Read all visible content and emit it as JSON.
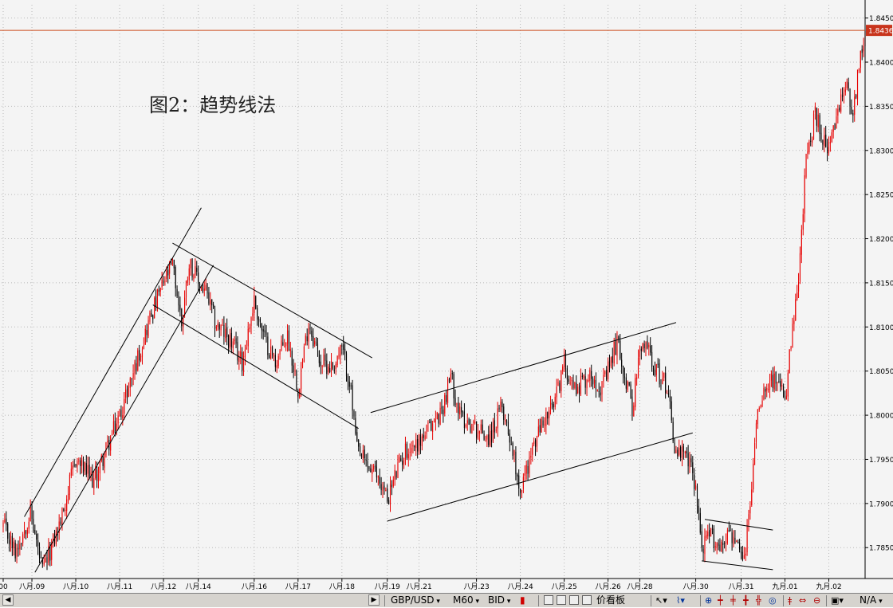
{
  "annotation": "图2：趋势线法",
  "colors": {
    "background": "#f4f4f4",
    "grid": "#b8b8b8",
    "bull": "#e60000",
    "bear": "#000000",
    "trendline": "#000000",
    "price_line": "#cc4b1a",
    "price_box_bg": "#c8341c"
  },
  "bottom_bar": {
    "symbol": "GBP/USD",
    "timeframe": "M60",
    "price_type": "BID",
    "panel": "价看板",
    "status": "N/A"
  },
  "chart_data": {
    "type": "candlestick",
    "title": "",
    "timeframe": "H1",
    "ylim": [
      1.7815,
      1.8465
    ],
    "y_ticks": [
      "1.8450",
      "1.8400",
      "1.8350",
      "1.8300",
      "1.8250",
      "1.8200",
      "1.8150",
      "1.8100",
      "1.8050",
      "1.8000",
      "1.7950",
      "1.7900",
      "1.7850"
    ],
    "current_price": "1.8436",
    "x_ticks": [
      {
        "label": "00",
        "i": 0
      },
      {
        "label": "八月.09",
        "i": 19
      },
      {
        "label": "八月.10",
        "i": 48
      },
      {
        "label": "八月.11",
        "i": 77
      },
      {
        "label": "八月.12",
        "i": 106
      },
      {
        "label": "八月.14",
        "i": 129
      },
      {
        "label": "八月.16",
        "i": 166
      },
      {
        "label": "八月.17",
        "i": 195
      },
      {
        "label": "八月.18",
        "i": 224
      },
      {
        "label": "八月.19",
        "i": 254
      },
      {
        "label": "八月.21",
        "i": 275
      },
      {
        "label": "八月.23",
        "i": 313
      },
      {
        "label": "八月.24",
        "i": 342
      },
      {
        "label": "八月.25",
        "i": 371
      },
      {
        "label": "八月.26",
        "i": 400
      },
      {
        "label": "八月.28",
        "i": 421
      },
      {
        "label": "八月.30",
        "i": 458
      },
      {
        "label": "八月.31",
        "i": 488
      },
      {
        "label": "九月.01",
        "i": 517
      },
      {
        "label": "九月.02",
        "i": 546
      }
    ],
    "path": [
      [
        0,
        1.7875
      ],
      [
        8,
        1.7845
      ],
      [
        18,
        1.789
      ],
      [
        26,
        1.7822
      ],
      [
        38,
        1.788
      ],
      [
        48,
        1.795
      ],
      [
        60,
        1.7925
      ],
      [
        77,
        1.8
      ],
      [
        88,
        1.806
      ],
      [
        97,
        1.811
      ],
      [
        106,
        1.815
      ],
      [
        112,
        1.817
      ],
      [
        118,
        1.8105
      ],
      [
        123,
        1.8175
      ],
      [
        129,
        1.815
      ],
      [
        134,
        1.814
      ],
      [
        140,
        1.8105
      ],
      [
        150,
        1.8085
      ],
      [
        158,
        1.806
      ],
      [
        166,
        1.813
      ],
      [
        172,
        1.809
      ],
      [
        180,
        1.806
      ],
      [
        188,
        1.809
      ],
      [
        195,
        1.803
      ],
      [
        202,
        1.8105
      ],
      [
        210,
        1.806
      ],
      [
        218,
        1.8055
      ],
      [
        224,
        1.8075
      ],
      [
        229,
        1.804
      ],
      [
        234,
        1.796
      ],
      [
        242,
        1.794
      ],
      [
        248,
        1.793
      ],
      [
        254,
        1.7905
      ],
      [
        260,
        1.7935
      ],
      [
        266,
        1.796
      ],
      [
        275,
        1.797
      ],
      [
        282,
        1.7985
      ],
      [
        290,
        1.8005
      ],
      [
        296,
        1.8045
      ],
      [
        302,
        1.8
      ],
      [
        313,
        1.7985
      ],
      [
        322,
        1.7975
      ],
      [
        330,
        1.801
      ],
      [
        336,
        1.797
      ],
      [
        342,
        1.7915
      ],
      [
        348,
        1.795
      ],
      [
        356,
        1.799
      ],
      [
        364,
        1.801
      ],
      [
        371,
        1.806
      ],
      [
        378,
        1.803
      ],
      [
        384,
        1.804
      ],
      [
        390,
        1.8045
      ],
      [
        396,
        1.803
      ],
      [
        400,
        1.805
      ],
      [
        406,
        1.8085
      ],
      [
        411,
        1.8045
      ],
      [
        416,
        1.801
      ],
      [
        421,
        1.807
      ],
      [
        426,
        1.808
      ],
      [
        432,
        1.805
      ],
      [
        436,
        1.804
      ],
      [
        440,
        1.803
      ],
      [
        444,
        1.796
      ],
      [
        449,
        1.7955
      ],
      [
        454,
        1.7945
      ],
      [
        458,
        1.792
      ],
      [
        462,
        1.785
      ],
      [
        468,
        1.7865
      ],
      [
        474,
        1.785
      ],
      [
        480,
        1.787
      ],
      [
        485,
        1.785
      ],
      [
        490,
        1.7835
      ],
      [
        494,
        1.79
      ],
      [
        499,
        1.801
      ],
      [
        505,
        1.804
      ],
      [
        511,
        1.804
      ],
      [
        517,
        1.8015
      ],
      [
        521,
        1.808
      ],
      [
        526,
        1.815
      ],
      [
        531,
        1.829
      ],
      [
        537,
        1.834
      ],
      [
        543,
        1.831
      ],
      [
        546,
        1.83
      ],
      [
        552,
        1.834
      ],
      [
        558,
        1.838
      ],
      [
        562,
        1.834
      ],
      [
        566,
        1.84
      ],
      [
        570,
        1.8436
      ]
    ],
    "trendlines": [
      {
        "i1": 14,
        "p1": 1.7885,
        "i2": 131,
        "p2": 1.8235
      },
      {
        "i1": 21,
        "p1": 1.7822,
        "i2": 139,
        "p2": 1.817
      },
      {
        "i1": 112,
        "p1": 1.8195,
        "i2": 244,
        "p2": 1.8065
      },
      {
        "i1": 99,
        "p1": 1.8125,
        "i2": 235,
        "p2": 1.7985
      },
      {
        "i1": 243,
        "p1": 1.8003,
        "i2": 445,
        "p2": 1.8105
      },
      {
        "i1": 254,
        "p1": 1.788,
        "i2": 456,
        "p2": 1.798
      },
      {
        "i1": 464,
        "p1": 1.7882,
        "i2": 509,
        "p2": 1.787
      },
      {
        "i1": 462,
        "p1": 1.7835,
        "i2": 509,
        "p2": 1.7825
      }
    ]
  }
}
